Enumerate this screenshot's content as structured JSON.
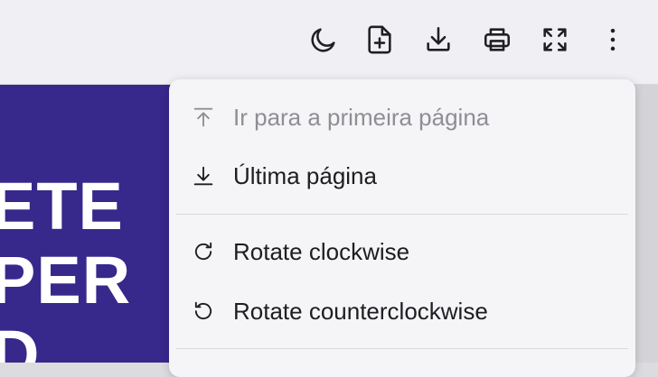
{
  "toolbar": {
    "buttons": [
      {
        "name": "dark-mode",
        "icon": "moon-icon"
      },
      {
        "name": "add-page",
        "icon": "file-plus-icon"
      },
      {
        "name": "download",
        "icon": "download-icon"
      },
      {
        "name": "print",
        "icon": "printer-icon"
      },
      {
        "name": "fullscreen",
        "icon": "expand-icon"
      },
      {
        "name": "more",
        "icon": "kebab-menu-icon"
      }
    ]
  },
  "document": {
    "lines": [
      "ETE",
      "PER",
      "D"
    ],
    "background_color": "#37288c"
  },
  "menu": {
    "items": [
      {
        "label": "Ir para a primeira página",
        "icon": "arrow-up-to-line-icon",
        "disabled": true
      },
      {
        "label": "Última página",
        "icon": "arrow-down-to-line-icon",
        "disabled": false
      },
      {
        "label": "Rotate clockwise",
        "icon": "rotate-clockwise-icon",
        "disabled": false
      },
      {
        "label": "Rotate counterclockwise",
        "icon": "rotate-counterclockwise-icon",
        "disabled": false
      }
    ]
  },
  "colors": {
    "toolbar_bg": "#f0f0f4",
    "menu_bg": "#f5f5f7",
    "text": "#1d1d22",
    "disabled_text": "#8e8e94"
  }
}
